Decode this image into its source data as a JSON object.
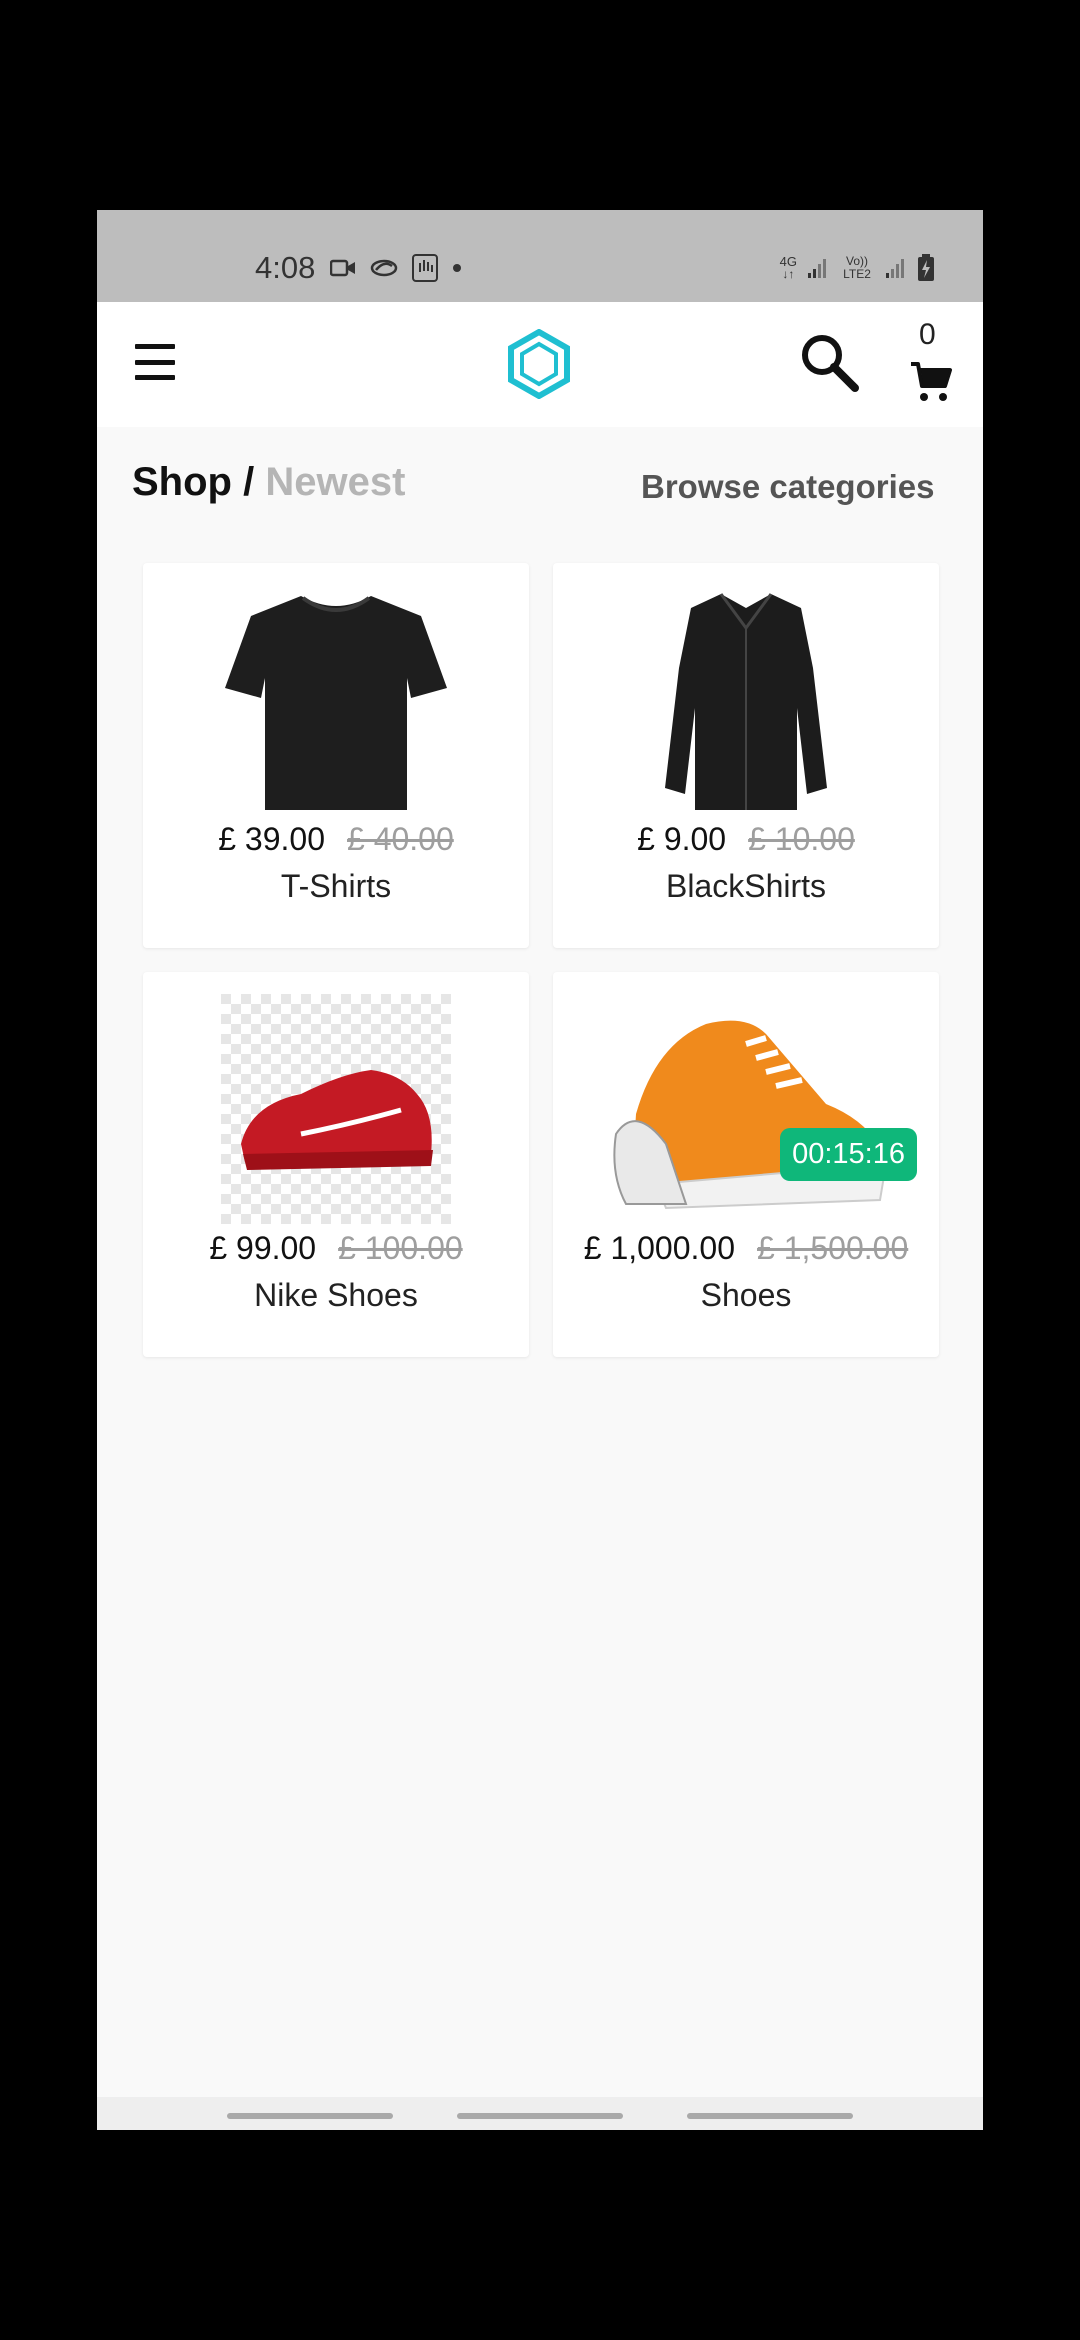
{
  "status_bar": {
    "time": "4:08",
    "icons_left": [
      "video-icon",
      "sync-icon",
      "gesture-icon",
      "dot-icon"
    ],
    "icons_right": [
      "network-4g-icon",
      "signal-icon",
      "volte-icon",
      "signal-2-icon",
      "battery-charging-icon"
    ],
    "network_label": "4G",
    "volte_label": "Vo)) LTE2"
  },
  "header": {
    "logo_color": "#1fbfd1",
    "cart_count": "0"
  },
  "breadcrumb": {
    "root": "Shop /",
    "current": "Newest"
  },
  "browse_label": "Browse categories",
  "products": [
    {
      "name": "T-Shirts",
      "price": "£ 39.00",
      "old_price": "£ 40.00",
      "image": "black-tshirt"
    },
    {
      "name": "BlackShirts",
      "price": "£ 9.00",
      "old_price": "£ 10.00",
      "image": "black-shirt"
    },
    {
      "name": "Nike Shoes",
      "price": "£ 99.00",
      "old_price": "£ 100.00",
      "image": "red-sneaker"
    },
    {
      "name": "Shoes",
      "price": "£ 1,000.00",
      "old_price": "£ 1,500.00",
      "image": "orange-sneaker",
      "timer": "00:15:16"
    }
  ],
  "colors": {
    "timer_badge": "#0fb77a",
    "old_price": "#9e9e9e"
  }
}
